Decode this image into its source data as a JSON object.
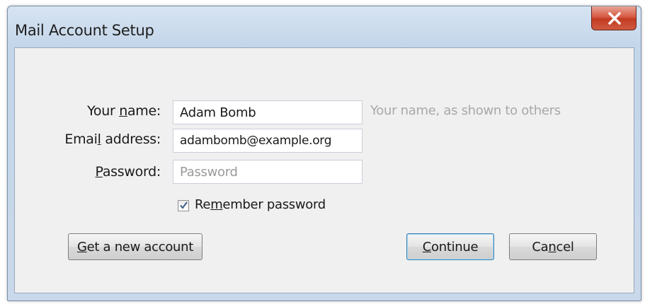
{
  "window": {
    "title": "Mail Account Setup"
  },
  "form": {
    "name_label_pre": "Your ",
    "name_label_key": "n",
    "name_label_post": "ame:",
    "name_value": "Adam Bomb",
    "name_hint": "Your name, as shown to others",
    "email_label_pre": "Emai",
    "email_label_key": "l",
    "email_label_post": " address:",
    "email_value": "adambomb@example.org",
    "password_label_pre": "",
    "password_label_key": "P",
    "password_label_post": "assword:",
    "password_value": "",
    "password_placeholder": "Password",
    "remember_checked": true,
    "remember_label_pre": "Re",
    "remember_label_key": "m",
    "remember_label_post": "ember password"
  },
  "buttons": {
    "get_new_pre": "",
    "get_new_key": "G",
    "get_new_post": "et a new account",
    "continue_pre": "",
    "continue_key": "C",
    "continue_post": "ontinue",
    "cancel_pre": "Ca",
    "cancel_key": "n",
    "cancel_post": "cel"
  },
  "icons": {
    "close": "close-icon",
    "check": "checkmark-icon"
  },
  "colors": {
    "close_button": "#c94a32",
    "default_button_border": "#3c7fb1",
    "hint_text": "#a8a8a8"
  }
}
